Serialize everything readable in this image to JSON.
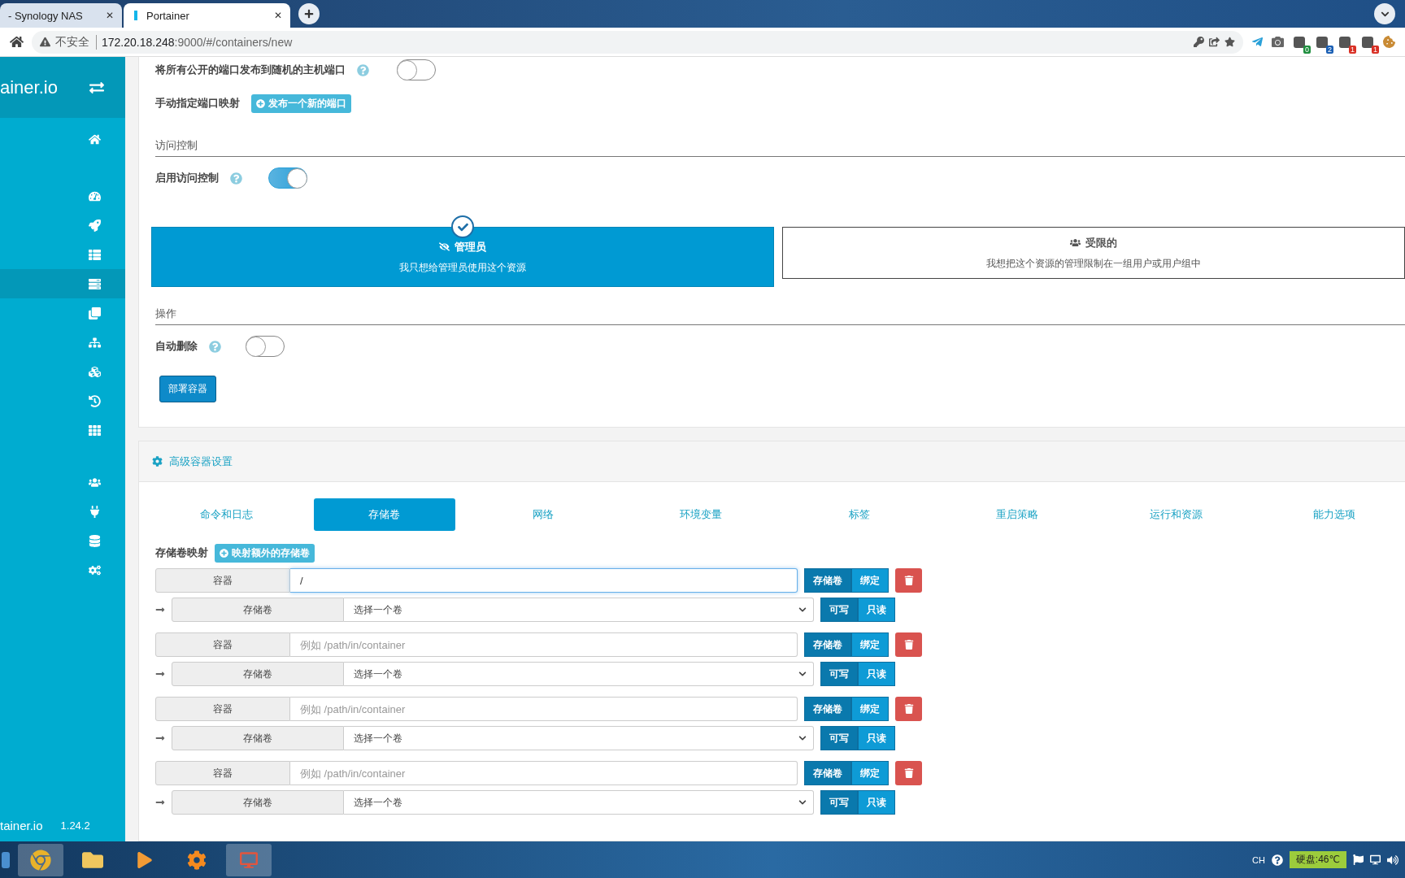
{
  "browser": {
    "tabs": [
      {
        "title": "- Synology NAS",
        "selected": false,
        "close": "✕"
      },
      {
        "title": "Portainer",
        "selected": true,
        "close": "✕"
      }
    ],
    "security": "不安全",
    "url_host": "172.20.18.248",
    "url_path": ":9000/#/containers/new",
    "extension_badges": [
      {
        "text": "0",
        "color": "#1e8e3e"
      },
      {
        "text": "2",
        "color": "#1a5fb4"
      },
      {
        "text": "1",
        "color": "#d93025"
      },
      {
        "text": "1",
        "color": "#d93025"
      }
    ]
  },
  "sidebar": {
    "logo": "ainer.io",
    "sections": [
      {
        "items": [
          {
            "selected": false
          }
        ]
      },
      {
        "items": [
          {
            "selected": false
          },
          {
            "selected": false
          },
          {
            "selected": false
          },
          {
            "selected": true
          },
          {
            "selected": false
          },
          {
            "selected": false
          },
          {
            "selected": false
          },
          {
            "selected": false
          },
          {
            "selected": false
          }
        ]
      },
      {
        "items": [
          {
            "selected": false
          },
          {
            "selected": false
          },
          {
            "selected": false
          },
          {
            "selected": false
          }
        ]
      }
    ],
    "footer_logo": "tainer.io",
    "version": "1.24.2"
  },
  "network_section": {
    "publish_all": {
      "label": "将所有公开的端口发布到随机的主机端口",
      "on": false
    },
    "manual_ports": {
      "label": "手动指定端口映射",
      "button": "发布一个新的端口"
    }
  },
  "access_control": {
    "heading": "访问控制",
    "enable": {
      "label": "启用访问控制",
      "on": true
    },
    "options": [
      {
        "kind": "admin",
        "title": "管理员",
        "description": "我只想给管理员使用这个资源",
        "selected": true
      },
      {
        "kind": "restricted",
        "title": "受限的",
        "description": "我想把这个资源的管理限制在一组用户或用户组中",
        "selected": false
      }
    ]
  },
  "actions": {
    "heading": "操作",
    "auto_remove": {
      "label": "自动删除",
      "on": false
    },
    "deploy_button": "部署容器"
  },
  "advanced": {
    "title": "高级容器设置",
    "tabs": [
      {
        "label": "命令和日志",
        "selected": false
      },
      {
        "label": "存储卷",
        "selected": true
      },
      {
        "label": "网络",
        "selected": false
      },
      {
        "label": "环境变量",
        "selected": false
      },
      {
        "label": "标签",
        "selected": false
      },
      {
        "label": "重启策略",
        "selected": false
      },
      {
        "label": "运行和资源",
        "selected": false
      },
      {
        "label": "能力选项",
        "selected": false
      }
    ],
    "volumes_label": "存储卷映射",
    "add_volume_button": "映射额外的存储卷",
    "volumes": [
      {
        "container_label": "容器",
        "container_value": "/",
        "focused": true,
        "type_options": [
          {
            "label": "存储卷",
            "selected": true
          },
          {
            "label": "绑定",
            "selected": false
          }
        ],
        "volume_label": "存储卷",
        "volume_select": "选择一个卷",
        "mode_options": [
          {
            "label": "可写",
            "selected": true
          },
          {
            "label": "只读",
            "selected": false
          }
        ]
      },
      {
        "container_label": "容器",
        "container_placeholder": "例如 /path/in/container",
        "focused": false,
        "type_options": [
          {
            "label": "存储卷",
            "selected": true
          },
          {
            "label": "绑定",
            "selected": false
          }
        ],
        "volume_label": "存储卷",
        "volume_select": "选择一个卷",
        "mode_options": [
          {
            "label": "可写",
            "selected": true
          },
          {
            "label": "只读",
            "selected": false
          }
        ]
      },
      {
        "container_label": "容器",
        "container_placeholder": "例如 /path/in/container",
        "focused": false,
        "type_options": [
          {
            "label": "存储卷",
            "selected": true
          },
          {
            "label": "绑定",
            "selected": false
          }
        ],
        "volume_label": "存储卷",
        "volume_select": "选择一个卷",
        "mode_options": [
          {
            "label": "可写",
            "selected": true
          },
          {
            "label": "只读",
            "selected": false
          }
        ]
      },
      {
        "container_label": "容器",
        "container_placeholder": "例如 /path/in/container",
        "focused": false,
        "type_options": [
          {
            "label": "存储卷",
            "selected": true
          },
          {
            "label": "绑定",
            "selected": false
          }
        ],
        "volume_label": "存储卷",
        "volume_select": "选择一个卷",
        "mode_options": [
          {
            "label": "可写",
            "selected": true
          },
          {
            "label": "只读",
            "selected": false
          }
        ]
      }
    ]
  },
  "taskbar": {
    "language": "CH",
    "disk_temp": "硬盘:46℃"
  }
}
